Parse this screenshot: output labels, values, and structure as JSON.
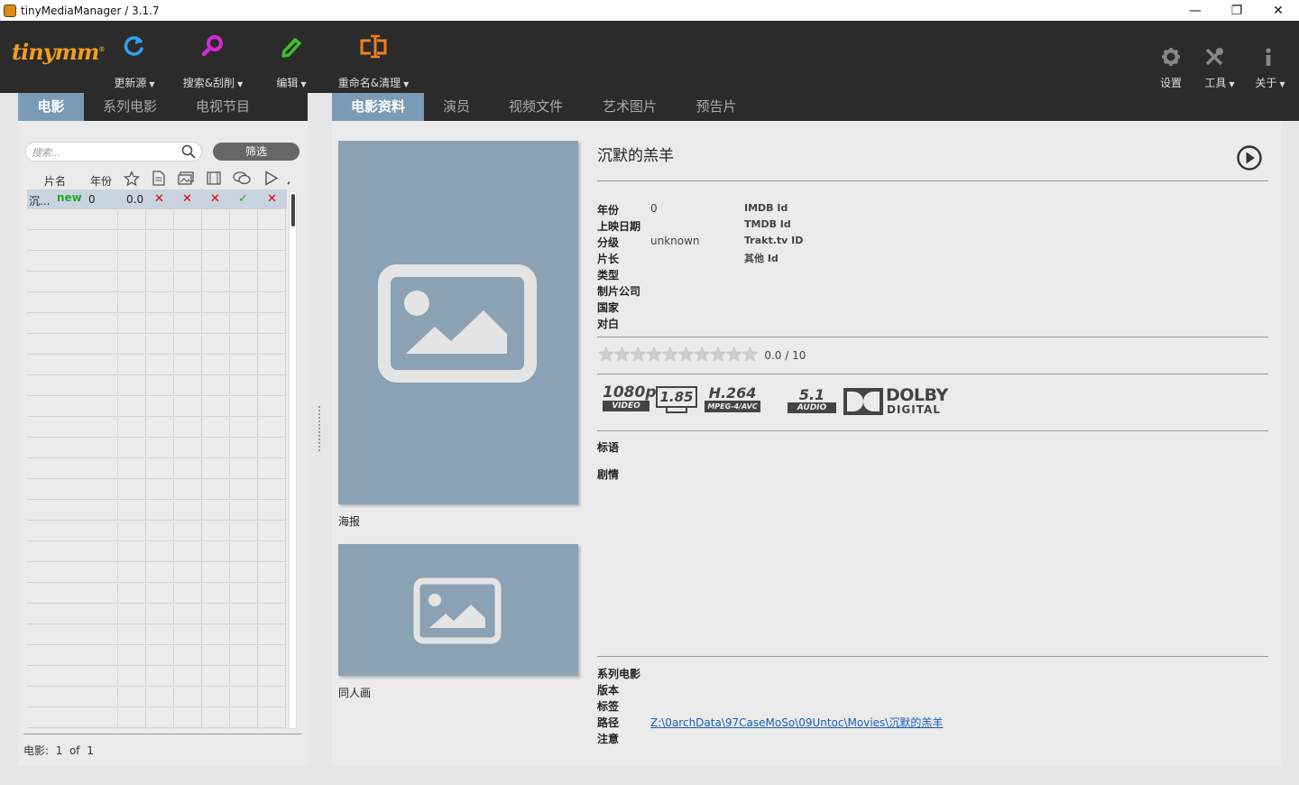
{
  "window": {
    "title": "tinyMediaManager / 3.1.7",
    "controls": [
      "—",
      "❐",
      "✕"
    ]
  },
  "logo": {
    "text": "tinymm",
    "mark": "®"
  },
  "toolbar": {
    "left": [
      {
        "label": "更新源",
        "icon": "refresh-icon",
        "color": "#2ea3f2"
      },
      {
        "label": "搜索&刮削",
        "icon": "search-icon",
        "color": "#d42ad4"
      },
      {
        "label": "编辑",
        "icon": "edit-icon",
        "color": "#3fbd28"
      },
      {
        "label": "重命名&清理",
        "icon": "rename-icon",
        "color": "#f07f1a"
      }
    ],
    "right": [
      {
        "label": "设置",
        "icon": "gear-icon"
      },
      {
        "label": "工具",
        "icon": "tools-icon"
      },
      {
        "label": "关于",
        "icon": "info-icon"
      }
    ]
  },
  "left_tabs": [
    "电影",
    "系列电影",
    "电视节目"
  ],
  "right_tabs": [
    "电影资料",
    "演员",
    "视频文件",
    "艺术图片",
    "预告片"
  ],
  "search": {
    "placeholder": "搜索..."
  },
  "filter_button": "筛选",
  "table": {
    "headers": {
      "title": "片名",
      "year": "年份"
    },
    "row": {
      "title": "沉...",
      "badge": "new",
      "year": "0",
      "rating": "0.0"
    }
  },
  "count": {
    "label": "电影:",
    "current": "1",
    "of": "of",
    "total": "1"
  },
  "movie": {
    "title": "沉默的羔羊",
    "fields": [
      {
        "label": "年份",
        "value": "0"
      },
      {
        "label": "上映日期",
        "value": ""
      },
      {
        "label": "分级",
        "value": "unknown"
      },
      {
        "label": "片长",
        "value": ""
      },
      {
        "label": "类型",
        "value": ""
      },
      {
        "label": "制片公司",
        "value": ""
      },
      {
        "label": "国家",
        "value": ""
      },
      {
        "label": "对白",
        "value": ""
      }
    ],
    "ids": [
      "IMDB Id",
      "TMDB Id",
      "Trakt.tv ID",
      "其他 Id"
    ],
    "rating_text": "0.0 / 10",
    "rating_value": 0,
    "media": {
      "resolution": "1080p",
      "res_sub": "VIDEO",
      "aspect": "1.85",
      "codec": "H.264",
      "codec_sub": "MPEG-4/AVC",
      "channels": "5.1",
      "channels_sub": "AUDIO",
      "audio_brand": "DOLBY",
      "audio_brand_sub": "DIGITAL"
    },
    "tagline_label": "标语",
    "plot_label": "剧情",
    "poster_caption": "海报",
    "fanart_caption": "同人画",
    "bottom": [
      {
        "label": "系列电影",
        "value": ""
      },
      {
        "label": "版本",
        "value": ""
      },
      {
        "label": "标签",
        "value": ""
      },
      {
        "label": "路径",
        "value": "Z:\\0archData\\97CaseMoSo\\09Untoc\\Movies\\沉默的羔羊"
      },
      {
        "label": "注意",
        "value": ""
      }
    ]
  },
  "colors": {
    "accent": "#7a9bb5",
    "poster_bg": "#8aa2b3",
    "toolbar_bg": "#2b2b2b",
    "logo": "#f39c1f"
  }
}
